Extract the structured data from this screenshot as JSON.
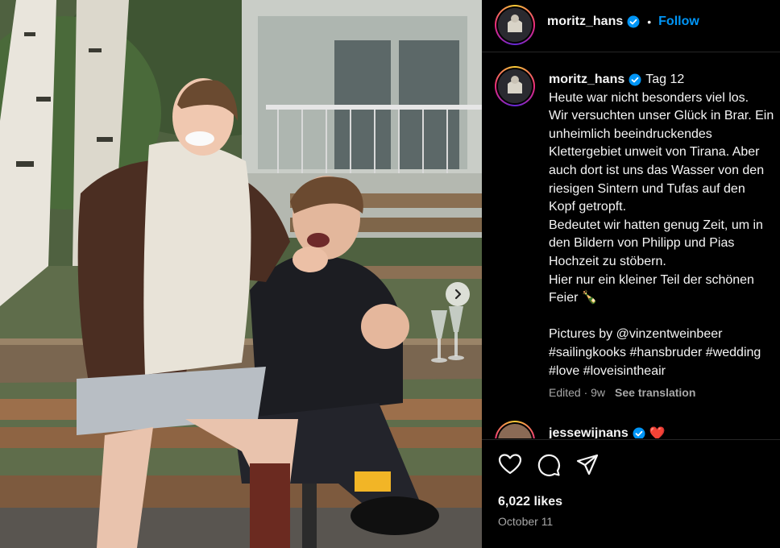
{
  "post": {
    "username": "moritz_hans",
    "follow_label": "Follow",
    "separator": "•",
    "caption_title": "Tag 12",
    "caption_lines": [
      "Heute war nicht besonders viel los.",
      "Wir versuchten unser Glück in Brar. Ein",
      "unheimlich beeindruckendes",
      "Klettergebiet unweit von Tirana. Aber",
      "auch dort ist uns das Wasser von den",
      "riesigen Sintern und Tufas auf den",
      "Kopf getropft.",
      "Bedeutet wir hatten genug Zeit, um in",
      "den Bildern von Philipp und Pias",
      "Hochzeit zu stöbern.",
      "Hier nur ein kleiner Teil der schönen",
      "Feier 🍾",
      "",
      "Pictures by @vinzentweinbeer",
      "#sailingkooks #hansbruder #wedding",
      "#love #loveisintheair"
    ],
    "edited_label": "Edited · 9w",
    "see_translation": "See translation",
    "likes": "6,022 likes",
    "date": "October 11"
  },
  "comment": {
    "username": "jessewijnans",
    "emoji": "❤️"
  },
  "icons": {
    "like": "heart-icon",
    "comment": "comment-icon",
    "share": "share-icon",
    "verified": "verified-badge-icon",
    "next": "chevron-right-icon"
  },
  "colors": {
    "background": "#000000",
    "link": "#0095f6",
    "muted": "#a8a8a8",
    "verified": "#0095f6"
  }
}
